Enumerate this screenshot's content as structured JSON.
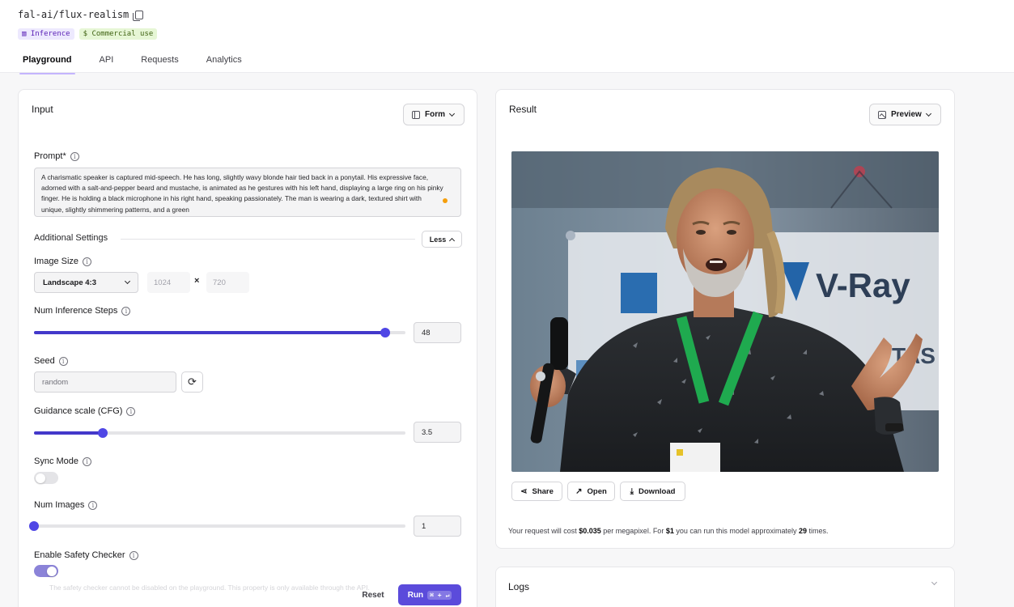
{
  "header": {
    "model_name": "fal-ai/flux-realism",
    "badges": [
      "▥ Inference",
      "$ Commercial use"
    ],
    "tabs": [
      "Playground",
      "API",
      "Requests",
      "Analytics"
    ],
    "active_tab": "Playground"
  },
  "input": {
    "title": "Input",
    "view_mode": "Form",
    "prompt_label": "Prompt*",
    "prompt_value": "A charismatic speaker is captured mid-speech. He has long, slightly wavy blonde hair tied back in a ponytail. His expressive face, adorned with a salt-and-pepper beard and mustache, is animated as he gestures with his left hand, displaying a large ring on his pinky finger. He is holding a black microphone in his right hand, speaking passionately. The man is wearing a dark, textured shirt with unique, slightly shimmering patterns, and a green",
    "additional_settings_label": "Additional Settings",
    "less_label": "Less",
    "image_size": {
      "label": "Image Size",
      "selected": "Landscape 4:3",
      "width": "1024",
      "separator": "×",
      "height": "720"
    },
    "inference_steps": {
      "label": "Num Inference Steps",
      "value": "48",
      "fraction": 0.945
    },
    "seed": {
      "label": "Seed",
      "placeholder": "random",
      "refresh_glyph": "⟳"
    },
    "guidance": {
      "label": "Guidance scale (CFG)",
      "value": "3.5",
      "fraction": 0.185
    },
    "sync_mode": {
      "label": "Sync Mode",
      "on": false
    },
    "num_images": {
      "label": "Num Images",
      "value": "1",
      "fraction": 0.0
    },
    "safety_checker": {
      "label": "Enable Safety Checker",
      "on": true,
      "note": "The safety checker cannot be disabled on the playground. This property is only available through the API."
    },
    "reset_label": "Reset",
    "run_label": "Run",
    "run_shortcut": "⌘ + ↵"
  },
  "result": {
    "title": "Result",
    "view_mode": "Preview",
    "image_texts": {
      "brand": "V-Ray",
      "partial": "TAS"
    },
    "share_label": "Share",
    "open_label": "Open",
    "download_label": "Download",
    "cost": {
      "prefix": "Your request will cost",
      "price": "$0.035",
      "mid": "per megapixel. For",
      "dollar": "$1",
      "mid2": "you can run this model approximately",
      "times": "29",
      "suffix": "times."
    }
  },
  "logs": {
    "title": "Logs"
  },
  "colors": {
    "accent": "#5b4bdb",
    "slider_fill": "#4338ca",
    "lanyard_green": "#1faa4f"
  }
}
